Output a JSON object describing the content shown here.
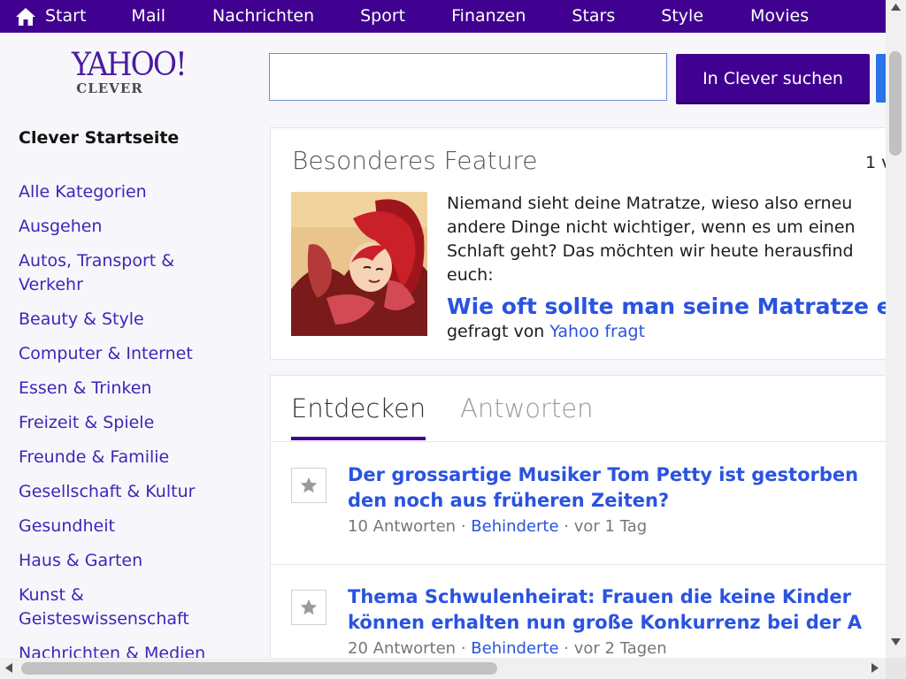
{
  "nav": {
    "items": [
      {
        "label": "Start",
        "icon": "home-icon"
      },
      {
        "label": "Mail"
      },
      {
        "label": "Nachrichten"
      },
      {
        "label": "Sport"
      },
      {
        "label": "Finanzen"
      },
      {
        "label": "Stars"
      },
      {
        "label": "Style"
      },
      {
        "label": "Movies"
      }
    ]
  },
  "logo": {
    "brand": "YAHOO!",
    "product": "CLEVER"
  },
  "sidebar": {
    "title": "Clever Startseite",
    "items": [
      "Alle Kategorien",
      "Ausgehen",
      "Autos, Transport & Verkehr",
      "Beauty & Style",
      "Computer & Internet",
      "Essen & Trinken",
      "Freizeit & Spiele",
      "Freunde & Familie",
      "Gesellschaft & Kultur",
      "Gesundheit",
      "Haus & Garten",
      "Kunst & Geisteswissenschaft",
      "Nachrichten & Medien"
    ]
  },
  "search": {
    "value": "",
    "placeholder": "",
    "button_label": "In Clever suchen"
  },
  "feature": {
    "heading": "Besonderes Feature",
    "counter": "1 v",
    "lines": [
      "Niemand sieht deine Matratze, wieso also erneu",
      "andere Dinge nicht wichtiger, wenn es um einen",
      "Schlaft geht? Das möchten wir heute herausfind",
      "euch:"
    ],
    "question": "Wie oft sollte man seine Matratze er",
    "asked_prefix": "gefragt von",
    "asked_by": "Yahoo fragt"
  },
  "discover": {
    "tabs": [
      "Entdecken",
      "Antworten"
    ],
    "questions": [
      {
        "title_lines": [
          "Der grossartige Musiker Tom Petty ist gestorben",
          "den noch aus früheren Zeiten?"
        ],
        "answers": "10 Antworten",
        "category": "Behinderte",
        "age": "vor 1 Tag"
      },
      {
        "title_lines": [
          "Thema Schwulenheirat: Frauen die keine Kinder",
          "können erhalten nun große Konkurrenz bei der A"
        ],
        "answers": "20 Antworten",
        "category": "Behinderte",
        "age": "vor 2 Tagen"
      }
    ]
  },
  "colors": {
    "brand": "#400090",
    "link": "#2a53e0",
    "side_link": "#3a28b8"
  }
}
